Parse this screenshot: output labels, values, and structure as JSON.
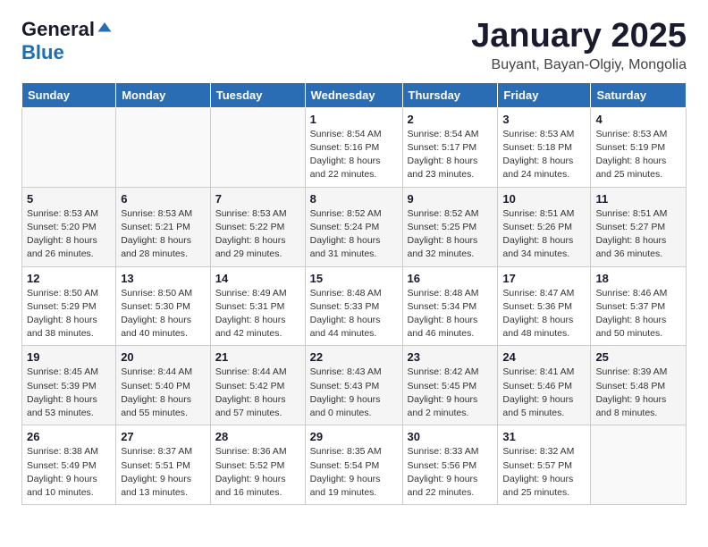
{
  "logo": {
    "general": "General",
    "blue": "Blue"
  },
  "title": {
    "month": "January 2025",
    "location": "Buyant, Bayan-Olgiy, Mongolia"
  },
  "days": [
    "Sunday",
    "Monday",
    "Tuesday",
    "Wednesday",
    "Thursday",
    "Friday",
    "Saturday"
  ],
  "weeks": [
    [
      {
        "date": "",
        "info": ""
      },
      {
        "date": "",
        "info": ""
      },
      {
        "date": "",
        "info": ""
      },
      {
        "date": "1",
        "info": "Sunrise: 8:54 AM\nSunset: 5:16 PM\nDaylight: 8 hours and 22 minutes."
      },
      {
        "date": "2",
        "info": "Sunrise: 8:54 AM\nSunset: 5:17 PM\nDaylight: 8 hours and 23 minutes."
      },
      {
        "date": "3",
        "info": "Sunrise: 8:53 AM\nSunset: 5:18 PM\nDaylight: 8 hours and 24 minutes."
      },
      {
        "date": "4",
        "info": "Sunrise: 8:53 AM\nSunset: 5:19 PM\nDaylight: 8 hours and 25 minutes."
      }
    ],
    [
      {
        "date": "5",
        "info": "Sunrise: 8:53 AM\nSunset: 5:20 PM\nDaylight: 8 hours and 26 minutes."
      },
      {
        "date": "6",
        "info": "Sunrise: 8:53 AM\nSunset: 5:21 PM\nDaylight: 8 hours and 28 minutes."
      },
      {
        "date": "7",
        "info": "Sunrise: 8:53 AM\nSunset: 5:22 PM\nDaylight: 8 hours and 29 minutes."
      },
      {
        "date": "8",
        "info": "Sunrise: 8:52 AM\nSunset: 5:24 PM\nDaylight: 8 hours and 31 minutes."
      },
      {
        "date": "9",
        "info": "Sunrise: 8:52 AM\nSunset: 5:25 PM\nDaylight: 8 hours and 32 minutes."
      },
      {
        "date": "10",
        "info": "Sunrise: 8:51 AM\nSunset: 5:26 PM\nDaylight: 8 hours and 34 minutes."
      },
      {
        "date": "11",
        "info": "Sunrise: 8:51 AM\nSunset: 5:27 PM\nDaylight: 8 hours and 36 minutes."
      }
    ],
    [
      {
        "date": "12",
        "info": "Sunrise: 8:50 AM\nSunset: 5:29 PM\nDaylight: 8 hours and 38 minutes."
      },
      {
        "date": "13",
        "info": "Sunrise: 8:50 AM\nSunset: 5:30 PM\nDaylight: 8 hours and 40 minutes."
      },
      {
        "date": "14",
        "info": "Sunrise: 8:49 AM\nSunset: 5:31 PM\nDaylight: 8 hours and 42 minutes."
      },
      {
        "date": "15",
        "info": "Sunrise: 8:48 AM\nSunset: 5:33 PM\nDaylight: 8 hours and 44 minutes."
      },
      {
        "date": "16",
        "info": "Sunrise: 8:48 AM\nSunset: 5:34 PM\nDaylight: 8 hours and 46 minutes."
      },
      {
        "date": "17",
        "info": "Sunrise: 8:47 AM\nSunset: 5:36 PM\nDaylight: 8 hours and 48 minutes."
      },
      {
        "date": "18",
        "info": "Sunrise: 8:46 AM\nSunset: 5:37 PM\nDaylight: 8 hours and 50 minutes."
      }
    ],
    [
      {
        "date": "19",
        "info": "Sunrise: 8:45 AM\nSunset: 5:39 PM\nDaylight: 8 hours and 53 minutes."
      },
      {
        "date": "20",
        "info": "Sunrise: 8:44 AM\nSunset: 5:40 PM\nDaylight: 8 hours and 55 minutes."
      },
      {
        "date": "21",
        "info": "Sunrise: 8:44 AM\nSunset: 5:42 PM\nDaylight: 8 hours and 57 minutes."
      },
      {
        "date": "22",
        "info": "Sunrise: 8:43 AM\nSunset: 5:43 PM\nDaylight: 9 hours and 0 minutes."
      },
      {
        "date": "23",
        "info": "Sunrise: 8:42 AM\nSunset: 5:45 PM\nDaylight: 9 hours and 2 minutes."
      },
      {
        "date": "24",
        "info": "Sunrise: 8:41 AM\nSunset: 5:46 PM\nDaylight: 9 hours and 5 minutes."
      },
      {
        "date": "25",
        "info": "Sunrise: 8:39 AM\nSunset: 5:48 PM\nDaylight: 9 hours and 8 minutes."
      }
    ],
    [
      {
        "date": "26",
        "info": "Sunrise: 8:38 AM\nSunset: 5:49 PM\nDaylight: 9 hours and 10 minutes."
      },
      {
        "date": "27",
        "info": "Sunrise: 8:37 AM\nSunset: 5:51 PM\nDaylight: 9 hours and 13 minutes."
      },
      {
        "date": "28",
        "info": "Sunrise: 8:36 AM\nSunset: 5:52 PM\nDaylight: 9 hours and 16 minutes."
      },
      {
        "date": "29",
        "info": "Sunrise: 8:35 AM\nSunset: 5:54 PM\nDaylight: 9 hours and 19 minutes."
      },
      {
        "date": "30",
        "info": "Sunrise: 8:33 AM\nSunset: 5:56 PM\nDaylight: 9 hours and 22 minutes."
      },
      {
        "date": "31",
        "info": "Sunrise: 8:32 AM\nSunset: 5:57 PM\nDaylight: 9 hours and 25 minutes."
      },
      {
        "date": "",
        "info": ""
      }
    ]
  ]
}
